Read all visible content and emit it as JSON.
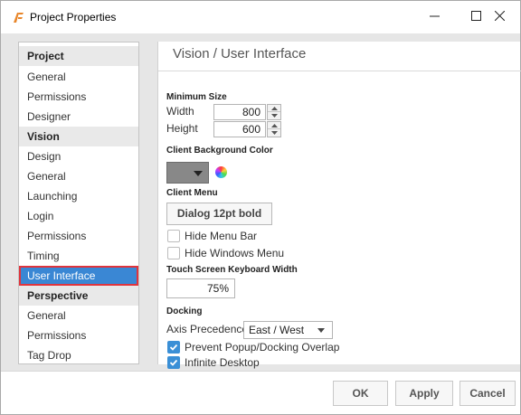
{
  "window": {
    "title": "Project Properties",
    "controls": {
      "minimize": "minimize-icon",
      "maximize": "maximize-icon",
      "close": "close-icon"
    }
  },
  "sidebar": {
    "items": [
      {
        "label": "Project",
        "kind": "header"
      },
      {
        "label": "General",
        "kind": "item"
      },
      {
        "label": "Permissions",
        "kind": "item"
      },
      {
        "label": "Designer",
        "kind": "item"
      },
      {
        "label": "Vision",
        "kind": "header"
      },
      {
        "label": "Design",
        "kind": "item"
      },
      {
        "label": "General",
        "kind": "item"
      },
      {
        "label": "Launching",
        "kind": "item"
      },
      {
        "label": "Login",
        "kind": "item"
      },
      {
        "label": "Permissions",
        "kind": "item"
      },
      {
        "label": "Timing",
        "kind": "item"
      },
      {
        "label": "User Interface",
        "kind": "item",
        "selected": true
      },
      {
        "label": "Perspective",
        "kind": "header"
      },
      {
        "label": "General",
        "kind": "item"
      },
      {
        "label": "Permissions",
        "kind": "item"
      },
      {
        "label": "Tag Drop",
        "kind": "item"
      }
    ]
  },
  "main": {
    "title": "Vision / User Interface",
    "minimum_size": {
      "section": "Minimum Size",
      "width_label": "Width",
      "width_value": "800",
      "height_label": "Height",
      "height_value": "600"
    },
    "background": {
      "section": "Client Background Color",
      "color": "#888888"
    },
    "client_menu": {
      "section": "Client Menu",
      "font_button": "Dialog 12pt bold",
      "hide_menu_bar": {
        "label": "Hide Menu Bar",
        "checked": false
      },
      "hide_windows_menu": {
        "label": "Hide Windows Menu",
        "checked": false
      }
    },
    "keyboard": {
      "section": "Touch Screen Keyboard Width",
      "value": "75%"
    },
    "docking": {
      "section": "Docking",
      "axis_label": "Axis Precedence",
      "axis_value": "East / West",
      "prevent_overlap": {
        "label": "Prevent Popup/Docking Overlap",
        "checked": true
      },
      "infinite_desktop": {
        "label": "Infinite Desktop",
        "checked": true
      }
    }
  },
  "footer": {
    "ok": "OK",
    "apply": "Apply",
    "cancel": "Cancel"
  },
  "colors": {
    "accent": "#3a87d4",
    "selection_outline": "#e0343c",
    "checkbox": "#3a8fd6"
  }
}
